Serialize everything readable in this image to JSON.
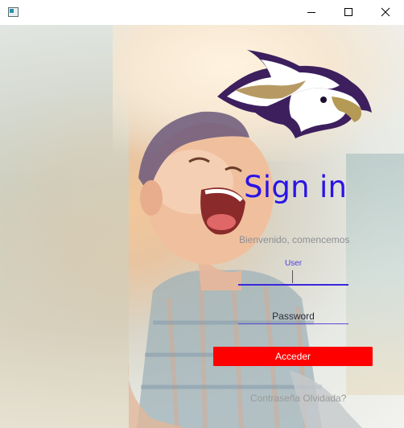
{
  "window": {
    "title": "",
    "controls": {
      "minimize": "minimize-icon",
      "maximize": "maximize-icon",
      "close": "close-icon"
    }
  },
  "login": {
    "title": "Sign in",
    "welcome": "Bienvenido, comencemos",
    "user_label": "User",
    "user_value": "",
    "password_placeholder": "Password",
    "submit_label": "Acceder",
    "forgot_link": "Contraseña Olvidada?"
  },
  "colors": {
    "title": "#2a13e6",
    "submit_button": "#ff0000",
    "field_underline": "#3a26dc"
  },
  "images": {
    "logo": "eagle-logo",
    "background": "laughing-child-photo"
  }
}
